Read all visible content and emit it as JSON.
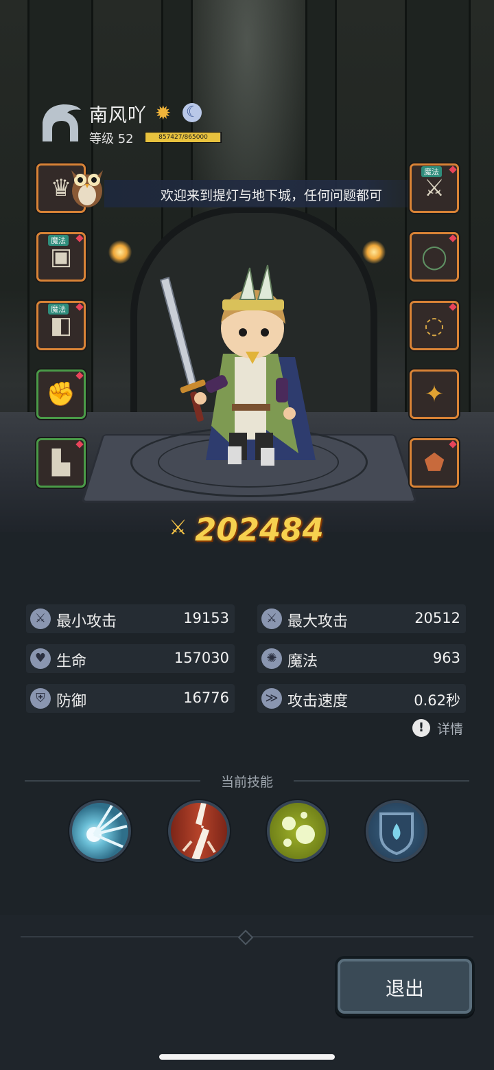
{
  "player": {
    "name": "南风吖",
    "level_label": "等级 52",
    "exp_text": "857427/865000",
    "exp_fraction": 0.991
  },
  "banner": {
    "message": "欢迎来到提灯与地下城，任何问题都可"
  },
  "equipment": {
    "badge_label": "魔法",
    "left": [
      {
        "name": "helmet",
        "icon": "helmet-icon",
        "frame": "orange"
      },
      {
        "name": "armor",
        "icon": "armor-icon",
        "frame": "orange",
        "badge": true
      },
      {
        "name": "boots",
        "icon": "boots-icon",
        "frame": "orange",
        "badge": true
      },
      {
        "name": "gloves",
        "icon": "gloves-icon",
        "frame": "green"
      },
      {
        "name": "cloak",
        "icon": "cloak-icon",
        "frame": "green"
      }
    ],
    "right": [
      {
        "name": "weapon",
        "icon": "sword-icon",
        "frame": "orange",
        "badge": true
      },
      {
        "name": "ring",
        "icon": "ring-icon",
        "frame": "orange"
      },
      {
        "name": "necklace",
        "icon": "necklace-icon",
        "frame": "orange"
      },
      {
        "name": "bracer",
        "icon": "bracer-icon",
        "frame": "orange"
      },
      {
        "name": "shield",
        "icon": "shield-icon",
        "frame": "orange"
      }
    ]
  },
  "power": {
    "value": "202484"
  },
  "stats": {
    "min_attack": {
      "label": "最小攻击",
      "value": "19153"
    },
    "max_attack": {
      "label": "最大攻击",
      "value": "20512"
    },
    "hp": {
      "label": "生命",
      "value": "157030"
    },
    "mana": {
      "label": "魔法",
      "value": "963"
    },
    "defense": {
      "label": "防御",
      "value": "16776"
    },
    "attack_speed": {
      "label": "攻击速度",
      "value": "0.62秒"
    },
    "details_label": "详情"
  },
  "skills": {
    "title": "当前技能",
    "items": [
      {
        "icon": "light-burst-icon",
        "color": "#2f6f8a"
      },
      {
        "icon": "lightning-strike-icon",
        "color": "#8c2f23"
      },
      {
        "icon": "bubbles-icon",
        "color": "#7a8a1c"
      },
      {
        "icon": "water-shield-icon",
        "color": "#2d4e6b"
      }
    ]
  },
  "actions": {
    "exit_label": "退出"
  },
  "colors": {
    "background": "#1d2328",
    "power_gold": "#f6d14f",
    "exp_bar": "#e8c23e"
  }
}
